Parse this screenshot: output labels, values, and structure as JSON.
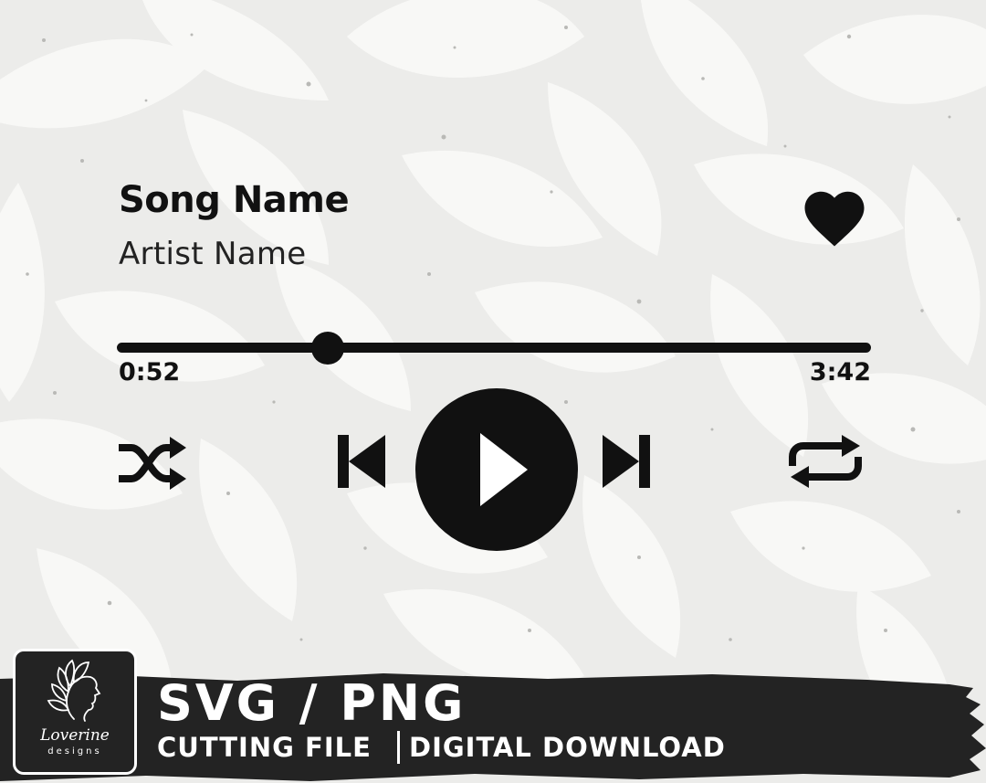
{
  "player": {
    "song_title": "Song Name",
    "artist": "Artist Name",
    "elapsed": "0:52",
    "duration": "3:42",
    "progress_fraction": 0.28,
    "liked": true
  },
  "controls": {
    "icons": [
      "shuffle-icon",
      "skip-previous-icon",
      "play-icon",
      "skip-next-icon",
      "repeat-icon",
      "heart-icon"
    ]
  },
  "banner": {
    "headline": "SVG / PNG",
    "sub_left": "CUTTING FILE",
    "sub_right": "DIGITAL DOWNLOAD",
    "logo_name": "Loverine",
    "logo_sub": "designs"
  },
  "colors": {
    "background": "#ececea",
    "pattern": "#f7f7f5",
    "foreground": "#111111",
    "banner": "#232323"
  }
}
